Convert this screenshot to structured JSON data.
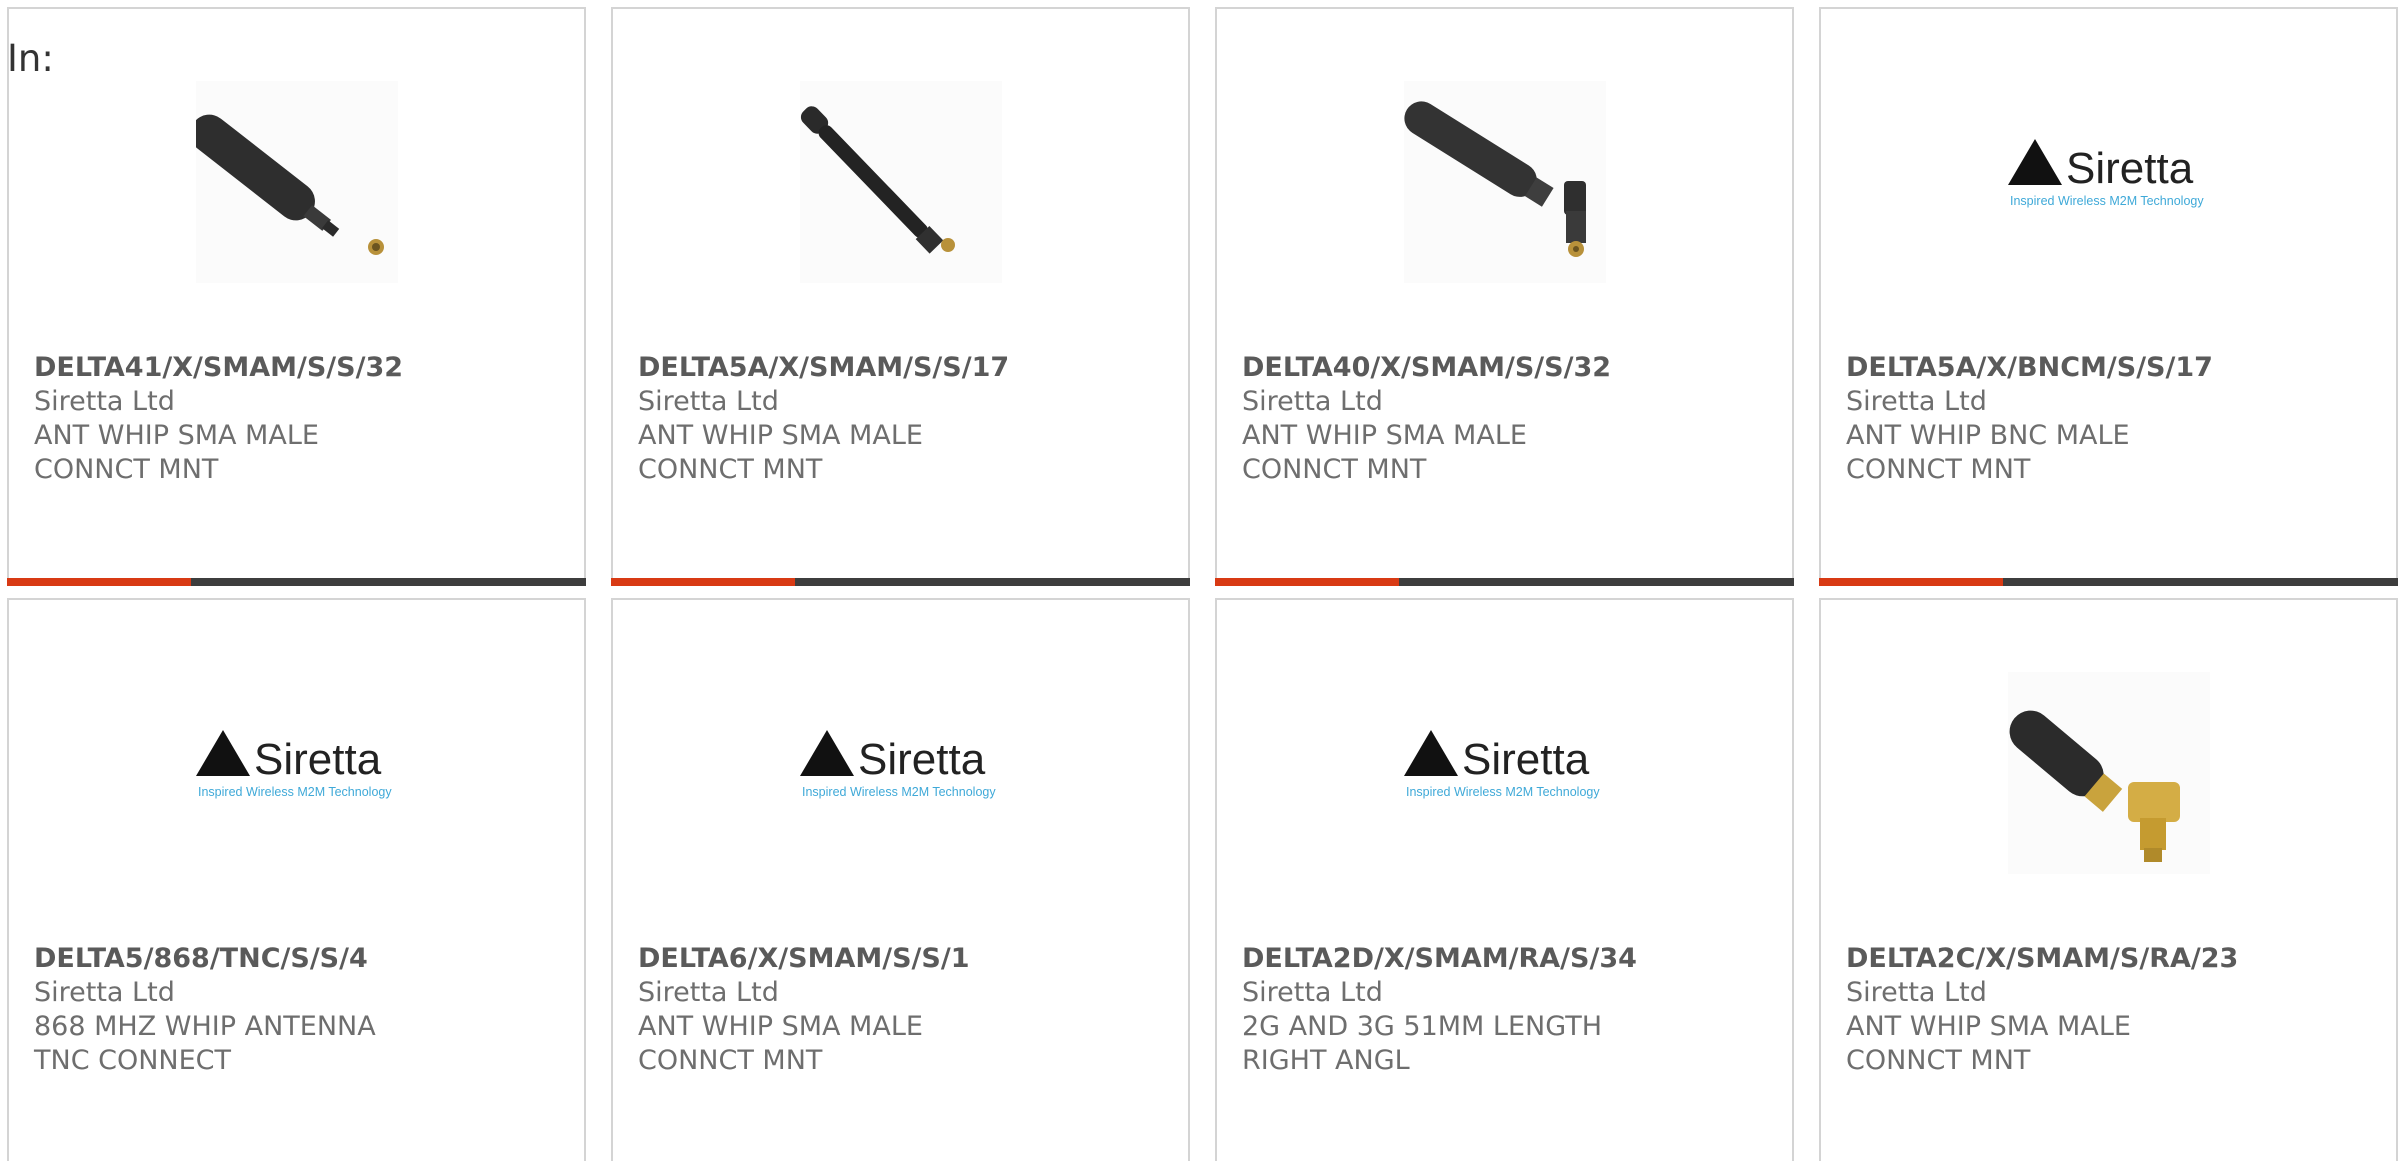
{
  "header": {
    "label": "In:"
  },
  "products": [
    {
      "part": "DELTA41/X/SMAM/S/S/32",
      "manufacturer": "Siretta Ltd",
      "description": "ANT WHIP SMA MALE CONNCT MNT",
      "image": "antenna-paddle-straight"
    },
    {
      "part": "DELTA5A/X/SMAM/S/S/17",
      "manufacturer": "Siretta Ltd",
      "description": "ANT WHIP SMA MALE CONNCT MNT",
      "image": "antenna-slim-straight"
    },
    {
      "part": "DELTA40/X/SMAM/S/S/32",
      "manufacturer": "Siretta Ltd",
      "description": "ANT WHIP SMA MALE CONNCT MNT",
      "image": "antenna-paddle-angled"
    },
    {
      "part": "DELTA5A/X/BNCM/S/S/17",
      "manufacturer": "Siretta Ltd",
      "description": "ANT WHIP BNC MALE CONNCT MNT",
      "image": "siretta-logo"
    },
    {
      "part": "DELTA5/868/TNC/S/S/4",
      "manufacturer": "Siretta Ltd",
      "description": "868 MHZ WHIP ANTENNA TNC CONNECT",
      "image": "siretta-logo"
    },
    {
      "part": "DELTA6/X/SMAM/S/S/1",
      "manufacturer": "Siretta Ltd",
      "description": "ANT WHIP SMA MALE CONNCT MNT",
      "image": "siretta-logo"
    },
    {
      "part": "DELTA2D/X/SMAM/RA/S/34",
      "manufacturer": "Siretta Ltd",
      "description": "2G AND 3G 51MM LENGTH RIGHT ANGL",
      "image": "siretta-logo"
    },
    {
      "part": "DELTA2C/X/SMAM/S/RA/23",
      "manufacturer": "Siretta Ltd",
      "description": "ANT WHIP SMA MALE CONNCT MNT",
      "image": "antenna-stubby-right-angle"
    }
  ],
  "logo": {
    "brand": "Siretta",
    "tagline": "Inspired Wireless M2M Technology"
  },
  "colors": {
    "accent": "#d83a14",
    "bar": "#3d3d3d",
    "border": "#d4d4d4",
    "text": "#6e6e6e",
    "logo_tagline": "#3fa9d8"
  }
}
